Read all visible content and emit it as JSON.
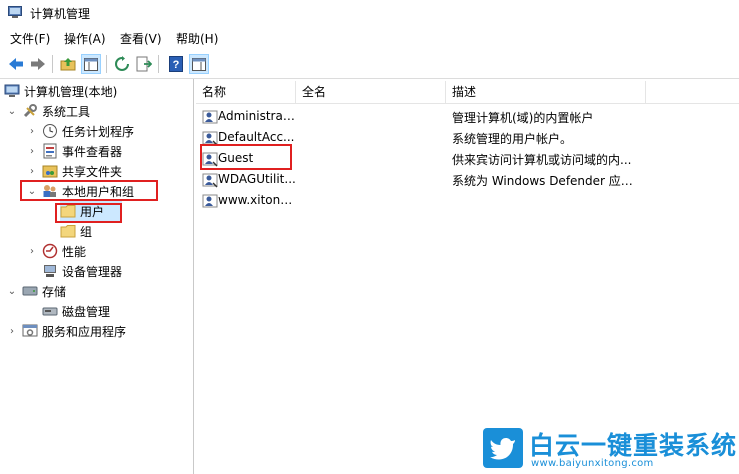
{
  "window": {
    "title": "计算机管理"
  },
  "menu": [
    "文件(F)",
    "操作(A)",
    "查看(V)",
    "帮助(H)"
  ],
  "toolbar": {
    "buttons": [
      "back-icon",
      "forward-icon",
      "up-folder-icon",
      "show-hide-tree-icon",
      "refresh-icon",
      "export-list-icon",
      "help-icon",
      "properties-icon"
    ]
  },
  "tree": {
    "root": "计算机管理(本地)",
    "system_tools": "系统工具",
    "task_scheduler": "任务计划程序",
    "event_viewer": "事件查看器",
    "shared_folders": "共享文件夹",
    "local_users_groups": "本地用户和组",
    "users": "用户",
    "groups": "组",
    "performance": "性能",
    "device_manager": "设备管理器",
    "storage": "存储",
    "disk_management": "磁盘管理",
    "services_apps": "服务和应用程序"
  },
  "list": {
    "headers": {
      "name": "名称",
      "full_name": "全名",
      "description": "描述"
    },
    "rows": [
      {
        "name": "Administrat...",
        "full_name": "",
        "description": "管理计算机(域)的内置帐户"
      },
      {
        "name": "DefaultAcc...",
        "full_name": "",
        "description": "系统管理的用户帐户。"
      },
      {
        "name": "Guest",
        "full_name": "",
        "description": "供来宾访问计算机或访问域的内..."
      },
      {
        "name": "WDAGUtilit...",
        "full_name": "",
        "description": "系统为 Windows Defender 应用..."
      },
      {
        "name": "www.xitong...",
        "full_name": "",
        "description": ""
      }
    ]
  },
  "watermark": {
    "title": "白云一键重装系统",
    "url": "www.baiyunxitong.com"
  },
  "colors": {
    "highlight": "#e02020",
    "selection": "#cce8ff",
    "watermark": "#1a8fd8"
  }
}
